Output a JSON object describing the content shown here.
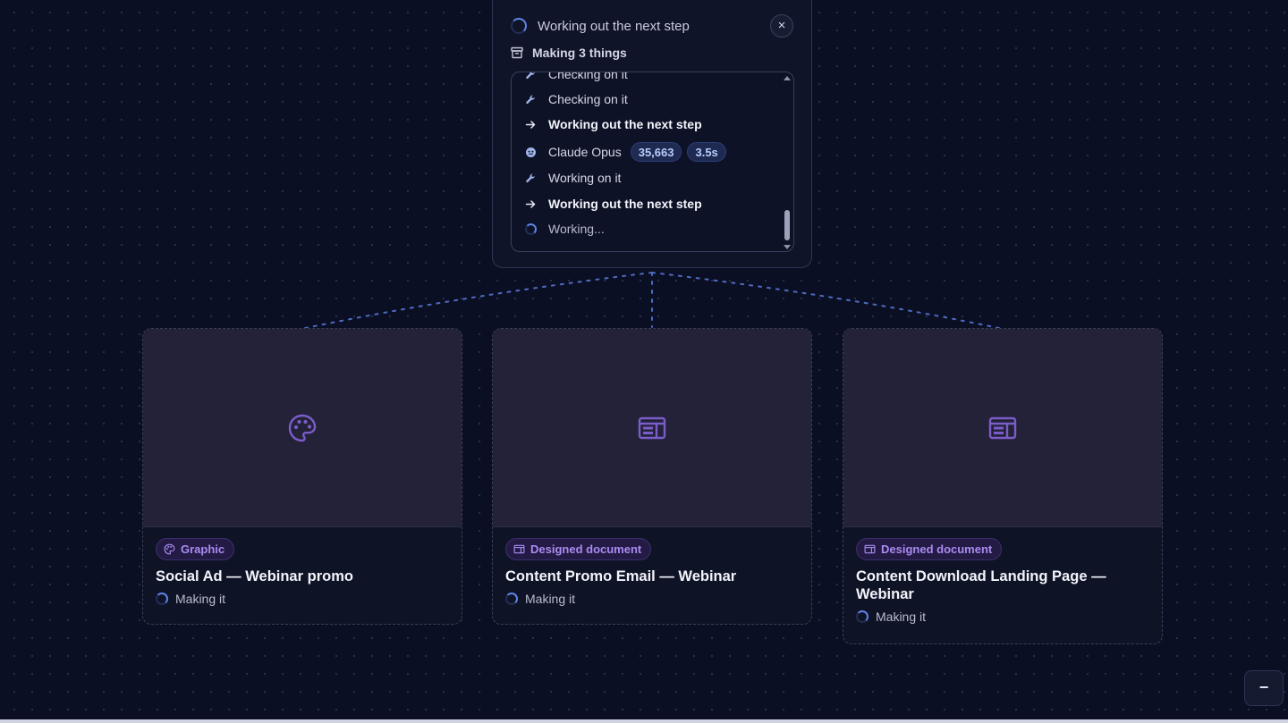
{
  "panel": {
    "title": "Working out the next step",
    "close_icon": "×",
    "making_label": "Making 3 things",
    "log": [
      {
        "icon": "tool-icon",
        "label": "Checking on it",
        "style": "normal"
      },
      {
        "icon": "tool-icon",
        "label": "Checking on it",
        "style": "normal"
      },
      {
        "icon": "arrow-right-icon",
        "label": "Working out the next step",
        "style": "bold"
      },
      {
        "icon": "model-icon",
        "label": "Claude Opus",
        "style": "normal",
        "tokens": "35,663",
        "duration": "3.5s"
      },
      {
        "icon": "tool-icon",
        "label": "Working on it",
        "style": "normal"
      },
      {
        "icon": "arrow-right-icon",
        "label": "Working out the next step",
        "style": "bold"
      },
      {
        "icon": "spinner-icon",
        "label": "Working...",
        "style": "dim"
      }
    ]
  },
  "cards": [
    {
      "preview_icon": "palette-icon",
      "badge_icon": "palette-icon",
      "badge": "Graphic",
      "title": "Social Ad — Webinar promo",
      "status": "Making it"
    },
    {
      "preview_icon": "layout-icon",
      "badge_icon": "layout-icon",
      "badge": "Designed document",
      "title": "Content Promo Email — Webinar",
      "status": "Making it"
    },
    {
      "preview_icon": "layout-icon",
      "badge_icon": "layout-icon",
      "badge": "Designed document",
      "title": "Content Download Landing Page — Webinar",
      "status": "Making it"
    }
  ],
  "zoom": {
    "minus_label": "−"
  },
  "colors": {
    "background": "#0b0f24",
    "accent_blue": "#5d84e6",
    "accent_purple": "#a98bf0",
    "card_preview": "#232238"
  }
}
